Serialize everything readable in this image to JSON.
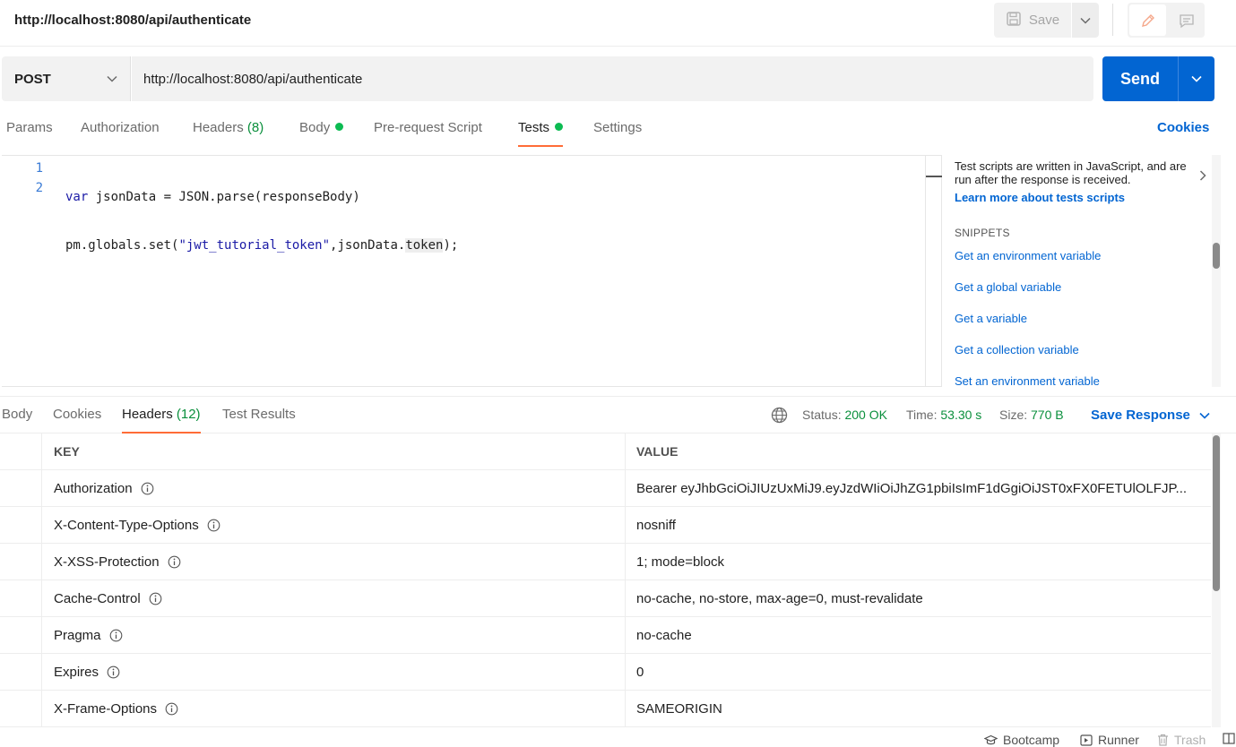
{
  "window": {
    "title": "http://localhost:8080/api/authenticate"
  },
  "toolbar": {
    "save_label": "Save"
  },
  "request": {
    "method": "POST",
    "url": "http://localhost:8080/api/authenticate",
    "send_label": "Send"
  },
  "request_tabs": {
    "params": "Params",
    "authorization": "Authorization",
    "headers": "Headers",
    "headers_count": "(8)",
    "body": "Body",
    "prerequest": "Pre-request Script",
    "tests": "Tests",
    "settings": "Settings",
    "cookies": "Cookies",
    "active": "Tests"
  },
  "editor": {
    "line_numbers": [
      "1",
      "2"
    ],
    "line1": {
      "kw": "var",
      "rest": " jsonData = ",
      "obj": "JSON",
      "fn": ".parse",
      "tail": "(responseBody)"
    },
    "line2": {
      "head": "pm.globals.set(",
      "str": "\"jwt_tutorial_token\"",
      "mid": ",jsonData.",
      "hl": "token",
      "tail": ");"
    }
  },
  "snippets_panel": {
    "description": "Test scripts are written in JavaScript, and are run after the response is received.",
    "learn_more": "Learn more about tests scripts",
    "heading": "SNIPPETS",
    "items": [
      "Get an environment variable",
      "Get a global variable",
      "Get a variable",
      "Get a collection variable",
      "Set an environment variable"
    ]
  },
  "response": {
    "tabs": {
      "body": "Body",
      "cookies": "Cookies",
      "headers": "Headers",
      "headers_count": "(12)",
      "test_results": "Test Results",
      "active": "Headers"
    },
    "status_label": "Status:",
    "status_value": "200 OK",
    "time_label": "Time:",
    "time_value": "53.30 s",
    "size_label": "Size:",
    "size_value": "770 B",
    "save_response": "Save Response",
    "table": {
      "columns": [
        "KEY",
        "VALUE"
      ],
      "rows": [
        {
          "key": "Authorization",
          "value": "Bearer eyJhbGciOiJIUzUxMiJ9.eyJzdWIiOiJhZG1pbiIsImF1dGgiOiJST0xFX0FETUlOLFJP..."
        },
        {
          "key": "X-Content-Type-Options",
          "value": "nosniff"
        },
        {
          "key": "X-XSS-Protection",
          "value": "1; mode=block"
        },
        {
          "key": "Cache-Control",
          "value": "no-cache, no-store, max-age=0, must-revalidate"
        },
        {
          "key": "Pragma",
          "value": "no-cache"
        },
        {
          "key": "Expires",
          "value": "0"
        },
        {
          "key": "X-Frame-Options",
          "value": "SAMEORIGIN"
        }
      ]
    }
  },
  "statusbar": {
    "bootcamp": "Bootcamp",
    "runner": "Runner",
    "trash": "Trash"
  },
  "colors": {
    "accent_blue": "#0265d2",
    "tab_underline": "#ff6c37",
    "status_green": "#0a8f3c",
    "dot_green": "#0cbb52"
  }
}
